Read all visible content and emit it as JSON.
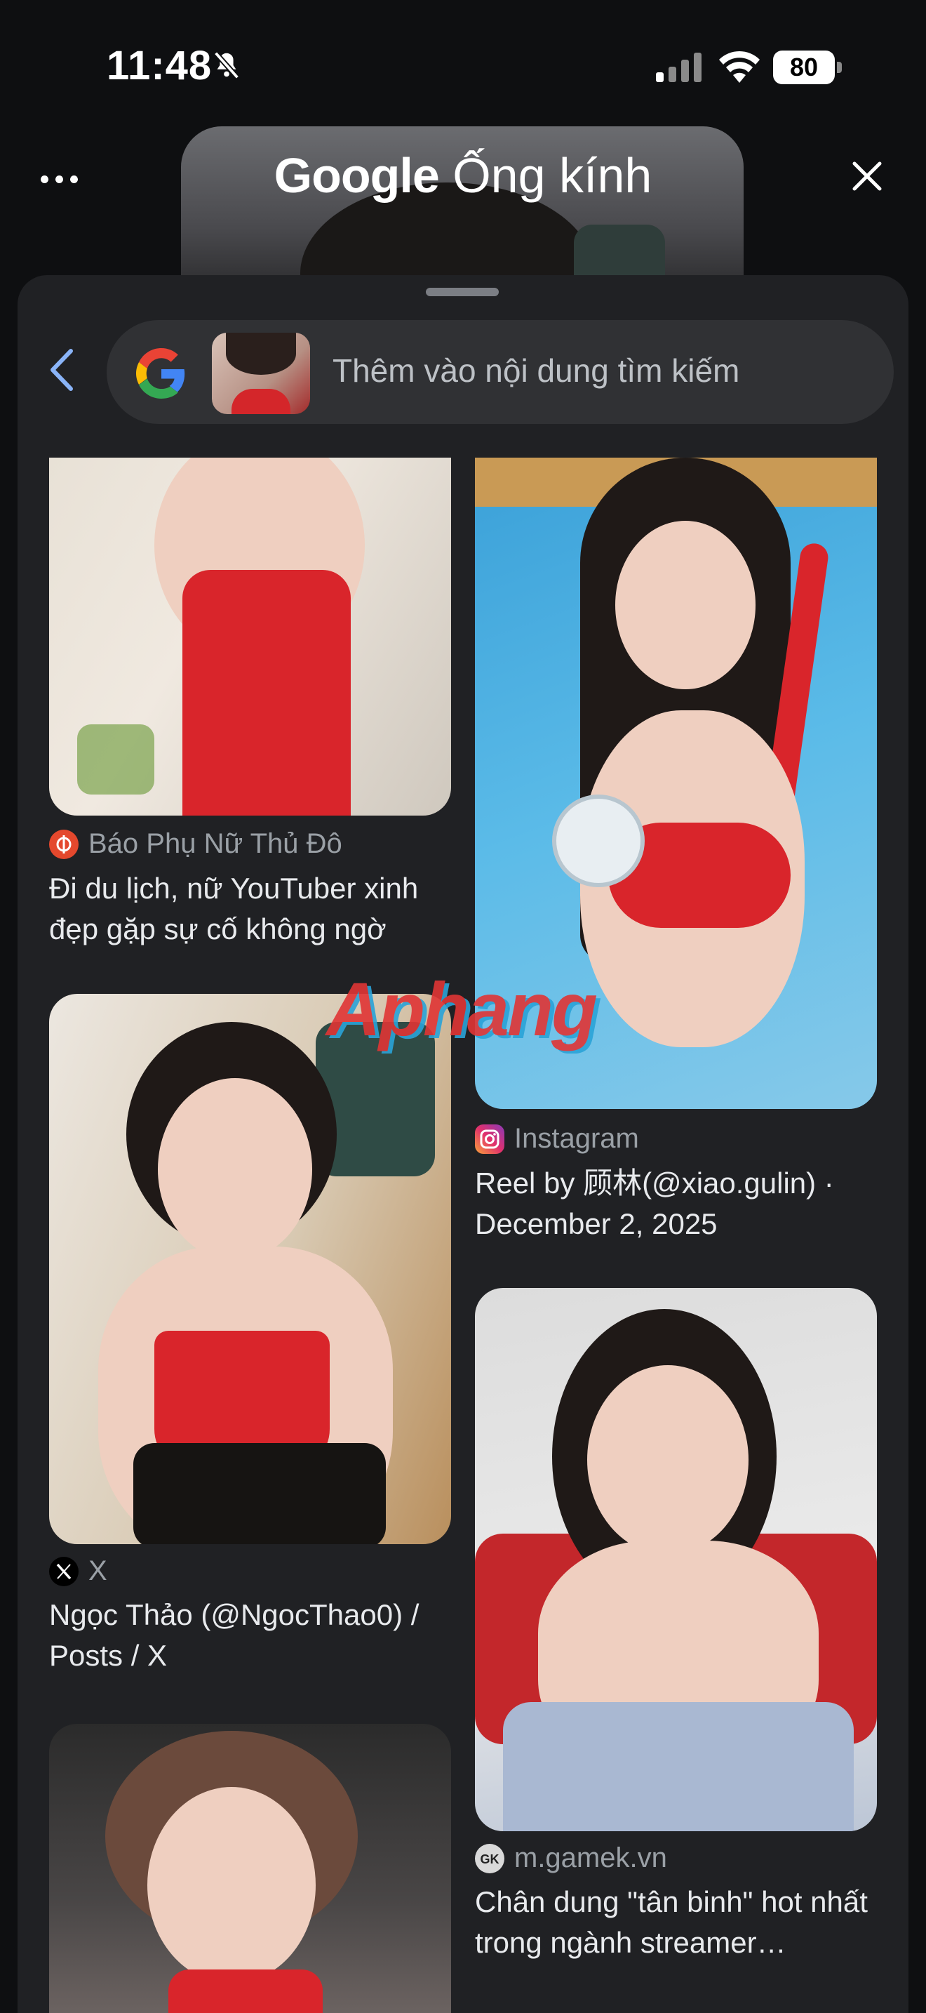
{
  "status_bar": {
    "time": "11:48",
    "battery": "80",
    "icons": [
      "bell-slash-icon",
      "signal-icon",
      "wifi-icon",
      "battery-icon"
    ]
  },
  "header": {
    "brand": "Google",
    "product": "Ống kính",
    "more_icon": "more-horizontal-icon",
    "close_icon": "close-icon"
  },
  "search": {
    "placeholder": "Thêm vào nội dung tìm kiếm",
    "back_icon": "chevron-left-icon",
    "logo_icon": "google-g-icon"
  },
  "results": [
    {
      "source": "Báo Phụ Nữ Thủ Đô",
      "source_icon": "bao-phu-nu-icon",
      "title": "Đi du lịch, nữ YouTuber xinh đẹp gặp sự cố không ngờ"
    },
    {
      "source": "Instagram",
      "source_icon": "instagram-icon",
      "title": "Reel by 顾林(@xiao.gulin) · December 2, 2025"
    },
    {
      "source": "X",
      "source_icon": "x-icon",
      "title": "Ngọc Thảo (@NgocThao0) / Posts / X"
    },
    {
      "source": "m.gamek.vn",
      "source_icon": "gamek-icon",
      "title": "Chân dung \"tân binh\" hot nhất trong ngành streamer…"
    }
  ],
  "watermark": "Aphang",
  "colors": {
    "background": "#0e0f11",
    "sheet": "#202124",
    "pill": "#303134",
    "accent": "#8ab4f8"
  }
}
